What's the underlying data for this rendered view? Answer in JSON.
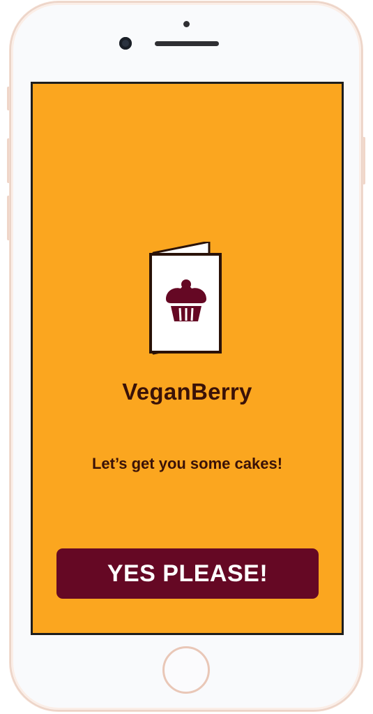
{
  "app": {
    "name": "VeganBerry",
    "tagline": "Let’s get you some cakes!",
    "cta_label": "YES PLEASE!"
  },
  "icons": {
    "logo": "menu-cupcake-icon"
  },
  "colors": {
    "background": "#fba61f",
    "text": "#3a1208",
    "button": "#650824",
    "button_text": "#ffffff"
  }
}
